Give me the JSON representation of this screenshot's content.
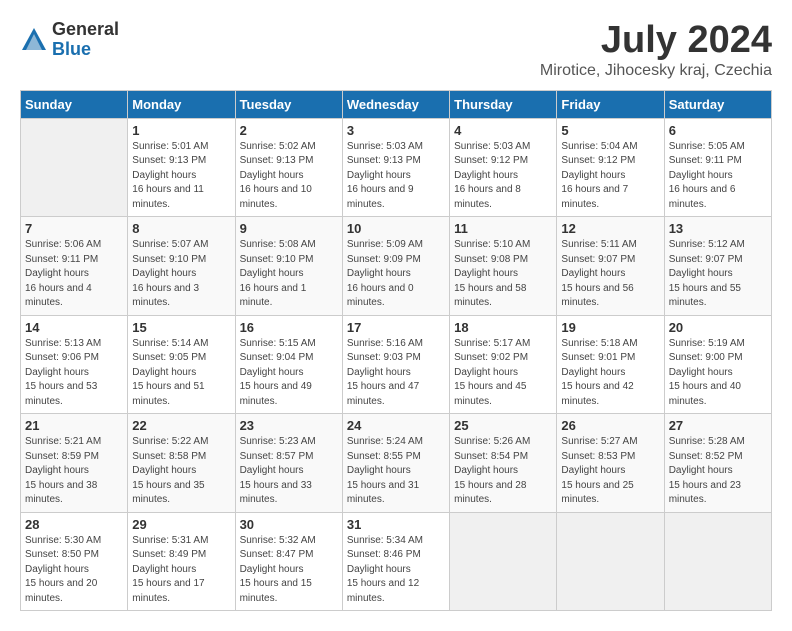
{
  "header": {
    "logo_general": "General",
    "logo_blue": "Blue",
    "month": "July 2024",
    "location": "Mirotice, Jihocesky kraj, Czechia"
  },
  "weekdays": [
    "Sunday",
    "Monday",
    "Tuesday",
    "Wednesday",
    "Thursday",
    "Friday",
    "Saturday"
  ],
  "weeks": [
    [
      {
        "day": "",
        "empty": true
      },
      {
        "day": "1",
        "sunrise": "5:01 AM",
        "sunset": "9:13 PM",
        "daylight": "16 hours and 11 minutes."
      },
      {
        "day": "2",
        "sunrise": "5:02 AM",
        "sunset": "9:13 PM",
        "daylight": "16 hours and 10 minutes."
      },
      {
        "day": "3",
        "sunrise": "5:03 AM",
        "sunset": "9:13 PM",
        "daylight": "16 hours and 9 minutes."
      },
      {
        "day": "4",
        "sunrise": "5:03 AM",
        "sunset": "9:12 PM",
        "daylight": "16 hours and 8 minutes."
      },
      {
        "day": "5",
        "sunrise": "5:04 AM",
        "sunset": "9:12 PM",
        "daylight": "16 hours and 7 minutes."
      },
      {
        "day": "6",
        "sunrise": "5:05 AM",
        "sunset": "9:11 PM",
        "daylight": "16 hours and 6 minutes."
      }
    ],
    [
      {
        "day": "7",
        "sunrise": "5:06 AM",
        "sunset": "9:11 PM",
        "daylight": "16 hours and 4 minutes."
      },
      {
        "day": "8",
        "sunrise": "5:07 AM",
        "sunset": "9:10 PM",
        "daylight": "16 hours and 3 minutes."
      },
      {
        "day": "9",
        "sunrise": "5:08 AM",
        "sunset": "9:10 PM",
        "daylight": "16 hours and 1 minute."
      },
      {
        "day": "10",
        "sunrise": "5:09 AM",
        "sunset": "9:09 PM",
        "daylight": "16 hours and 0 minutes."
      },
      {
        "day": "11",
        "sunrise": "5:10 AM",
        "sunset": "9:08 PM",
        "daylight": "15 hours and 58 minutes."
      },
      {
        "day": "12",
        "sunrise": "5:11 AM",
        "sunset": "9:07 PM",
        "daylight": "15 hours and 56 minutes."
      },
      {
        "day": "13",
        "sunrise": "5:12 AM",
        "sunset": "9:07 PM",
        "daylight": "15 hours and 55 minutes."
      }
    ],
    [
      {
        "day": "14",
        "sunrise": "5:13 AM",
        "sunset": "9:06 PM",
        "daylight": "15 hours and 53 minutes."
      },
      {
        "day": "15",
        "sunrise": "5:14 AM",
        "sunset": "9:05 PM",
        "daylight": "15 hours and 51 minutes."
      },
      {
        "day": "16",
        "sunrise": "5:15 AM",
        "sunset": "9:04 PM",
        "daylight": "15 hours and 49 minutes."
      },
      {
        "day": "17",
        "sunrise": "5:16 AM",
        "sunset": "9:03 PM",
        "daylight": "15 hours and 47 minutes."
      },
      {
        "day": "18",
        "sunrise": "5:17 AM",
        "sunset": "9:02 PM",
        "daylight": "15 hours and 45 minutes."
      },
      {
        "day": "19",
        "sunrise": "5:18 AM",
        "sunset": "9:01 PM",
        "daylight": "15 hours and 42 minutes."
      },
      {
        "day": "20",
        "sunrise": "5:19 AM",
        "sunset": "9:00 PM",
        "daylight": "15 hours and 40 minutes."
      }
    ],
    [
      {
        "day": "21",
        "sunrise": "5:21 AM",
        "sunset": "8:59 PM",
        "daylight": "15 hours and 38 minutes."
      },
      {
        "day": "22",
        "sunrise": "5:22 AM",
        "sunset": "8:58 PM",
        "daylight": "15 hours and 35 minutes."
      },
      {
        "day": "23",
        "sunrise": "5:23 AM",
        "sunset": "8:57 PM",
        "daylight": "15 hours and 33 minutes."
      },
      {
        "day": "24",
        "sunrise": "5:24 AM",
        "sunset": "8:55 PM",
        "daylight": "15 hours and 31 minutes."
      },
      {
        "day": "25",
        "sunrise": "5:26 AM",
        "sunset": "8:54 PM",
        "daylight": "15 hours and 28 minutes."
      },
      {
        "day": "26",
        "sunrise": "5:27 AM",
        "sunset": "8:53 PM",
        "daylight": "15 hours and 25 minutes."
      },
      {
        "day": "27",
        "sunrise": "5:28 AM",
        "sunset": "8:52 PM",
        "daylight": "15 hours and 23 minutes."
      }
    ],
    [
      {
        "day": "28",
        "sunrise": "5:30 AM",
        "sunset": "8:50 PM",
        "daylight": "15 hours and 20 minutes."
      },
      {
        "day": "29",
        "sunrise": "5:31 AM",
        "sunset": "8:49 PM",
        "daylight": "15 hours and 17 minutes."
      },
      {
        "day": "30",
        "sunrise": "5:32 AM",
        "sunset": "8:47 PM",
        "daylight": "15 hours and 15 minutes."
      },
      {
        "day": "31",
        "sunrise": "5:34 AM",
        "sunset": "8:46 PM",
        "daylight": "15 hours and 12 minutes."
      },
      {
        "day": "",
        "empty": true
      },
      {
        "day": "",
        "empty": true
      },
      {
        "day": "",
        "empty": true
      }
    ]
  ]
}
